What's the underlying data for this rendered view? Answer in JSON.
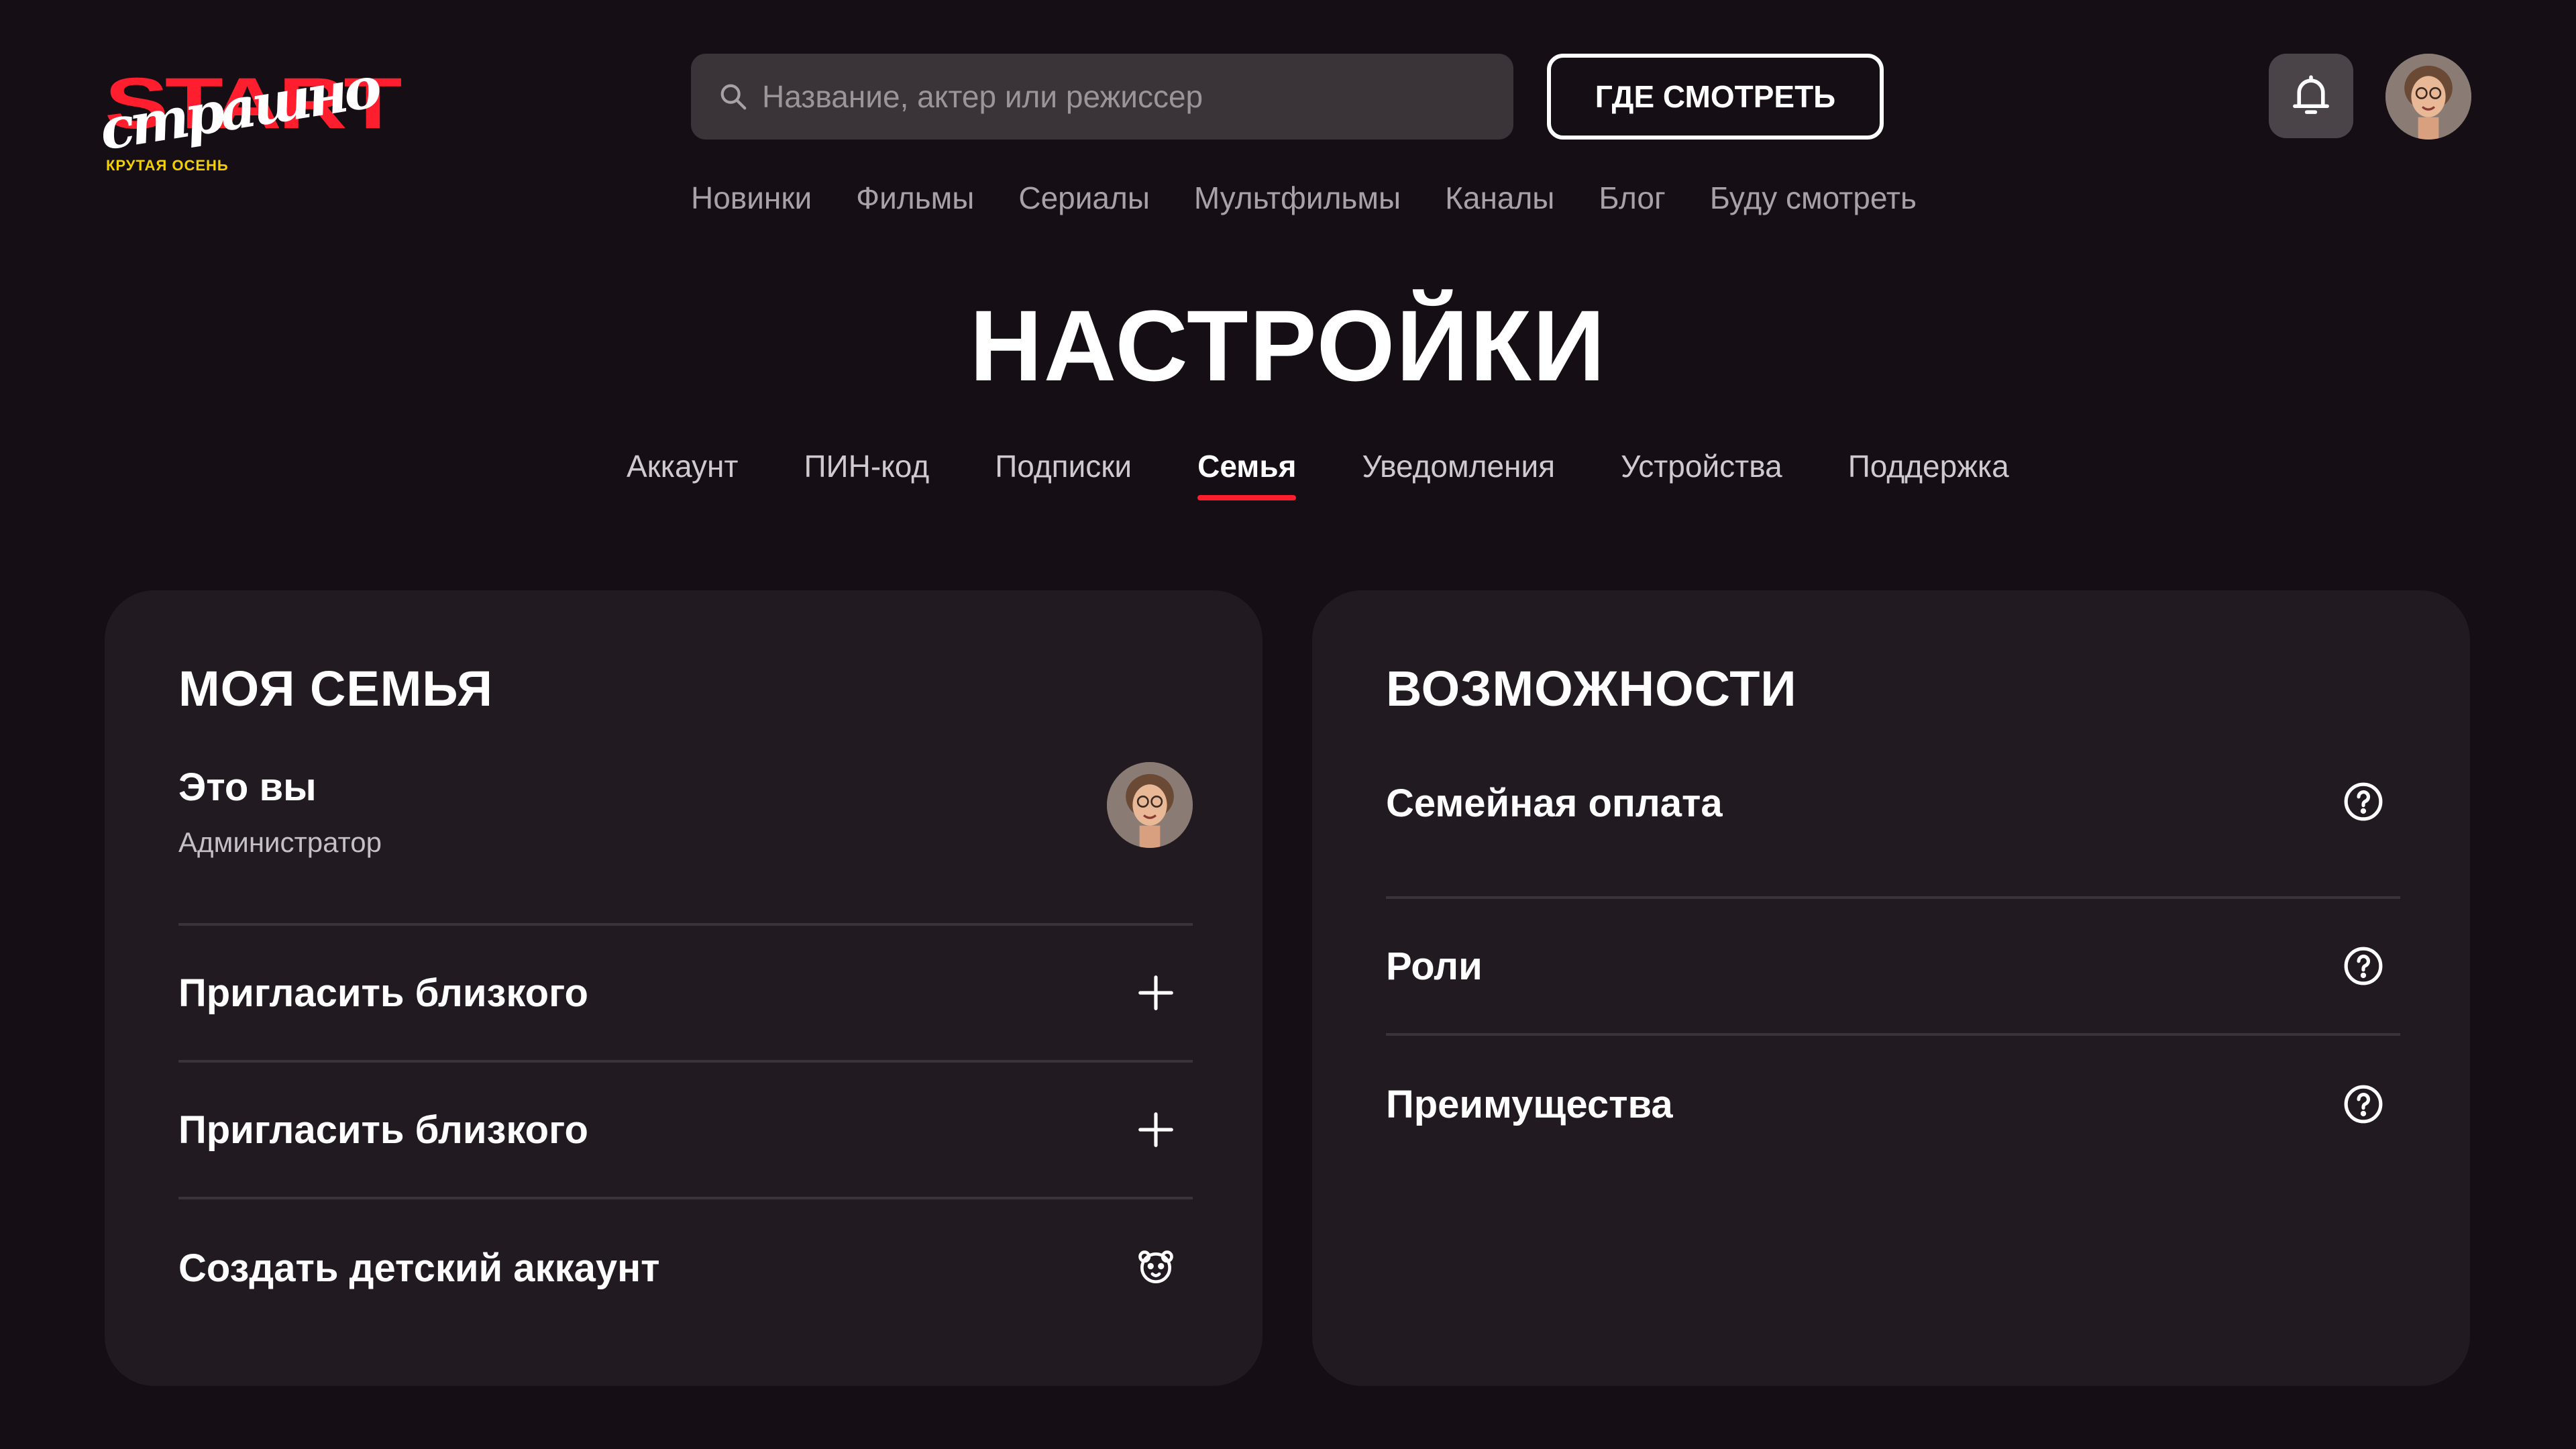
{
  "brand": {
    "logo_main": "START",
    "logo_script": "страшно",
    "logo_sub": "КРУТАЯ ОСЕНЬ",
    "accent_color": "#ff1e2d",
    "sub_color": "#f3d000"
  },
  "header": {
    "search": {
      "placeholder": "Название, актер или режиссер",
      "icon": "search-icon"
    },
    "where_to_watch_label": "ГДЕ СМОТРЕТЬ",
    "notifications_icon": "bell-icon"
  },
  "nav": {
    "items": [
      {
        "label": "Новинки"
      },
      {
        "label": "Фильмы"
      },
      {
        "label": "Сериалы"
      },
      {
        "label": "Мультфильмы"
      },
      {
        "label": "Каналы"
      },
      {
        "label": "Блог"
      },
      {
        "label": "Буду смотреть"
      }
    ]
  },
  "page": {
    "title": "НАСТРОЙКИ"
  },
  "tabs": {
    "active_index": 3,
    "items": [
      {
        "label": "Аккаунт"
      },
      {
        "label": "ПИН-код"
      },
      {
        "label": "Подписки"
      },
      {
        "label": "Семья"
      },
      {
        "label": "Уведомления"
      },
      {
        "label": "Устройства"
      },
      {
        "label": "Поддержка"
      }
    ]
  },
  "family": {
    "title": "МОЯ СЕМЬЯ",
    "me": {
      "name": "Это вы",
      "role": "Администратор"
    },
    "rows": [
      {
        "label": "Пригласить близкого",
        "icon": "plus-icon"
      },
      {
        "label": "Пригласить близкого",
        "icon": "plus-icon"
      },
      {
        "label": "Создать детский аккаунт",
        "icon": "bear-icon"
      }
    ]
  },
  "features": {
    "title": "ВОЗМОЖНОСТИ",
    "rows": [
      {
        "label": "Семейная оплата",
        "icon": "help-icon"
      },
      {
        "label": "Роли",
        "icon": "help-icon"
      },
      {
        "label": "Преимущества",
        "icon": "help-icon"
      }
    ]
  }
}
